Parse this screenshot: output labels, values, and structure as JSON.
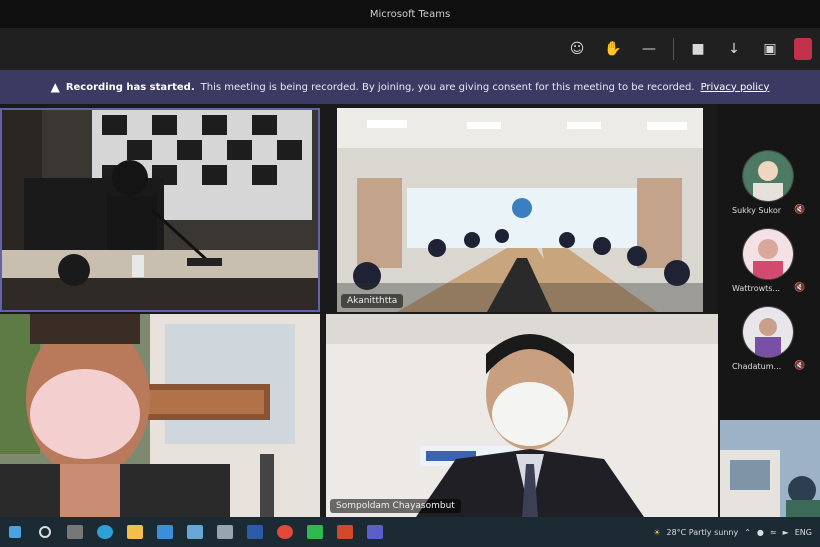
{
  "window": {
    "title": "Microsoft Teams"
  },
  "toolbar": {
    "buttons": [
      {
        "icon": "participants-icon",
        "glyph": "☺"
      },
      {
        "icon": "raise-hand-icon",
        "glyph": "✋"
      },
      {
        "icon": "more-icon",
        "glyph": "—"
      },
      {
        "icon": "camera-icon",
        "glyph": "■"
      },
      {
        "icon": "mic-off-icon",
        "glyph": "↓"
      },
      {
        "icon": "share-icon",
        "glyph": "▣"
      }
    ],
    "leave_color": "#c4314b"
  },
  "banner": {
    "title": "Recording has started.",
    "message": "This meeting is being recorded. By joining, you are giving consent for this meeting to be recorded.",
    "link": "Privacy policy"
  },
  "tiles": [
    {
      "id": "conference-room-camera"
    },
    {
      "id": "meeting-room-wide",
      "name": "Akanitthtta"
    },
    {
      "id": "masked-man-outdoor"
    },
    {
      "id": "presenter-suit",
      "name": "Sompoldam Chayasombut"
    }
  ],
  "participants": [
    {
      "name": "Sukky Sukor",
      "status": "mic-off"
    },
    {
      "name": "Wattrowts...",
      "status": "mic-off"
    },
    {
      "name": "Chadatum...",
      "status": "mic-off"
    }
  ],
  "taskbar": {
    "apps": [
      "search-icon",
      "task-view-icon",
      "edge-icon",
      "file-explorer-icon",
      "mail-icon",
      "store-icon",
      "word-icon",
      "chrome-icon",
      "line-icon",
      "powerpoint-icon",
      "teams-icon"
    ],
    "tray": {
      "weather": "28°C Partly sunny",
      "lang": "ENG"
    }
  },
  "colors": {
    "banner": "#3b3a63",
    "accent": "#6264a7"
  }
}
